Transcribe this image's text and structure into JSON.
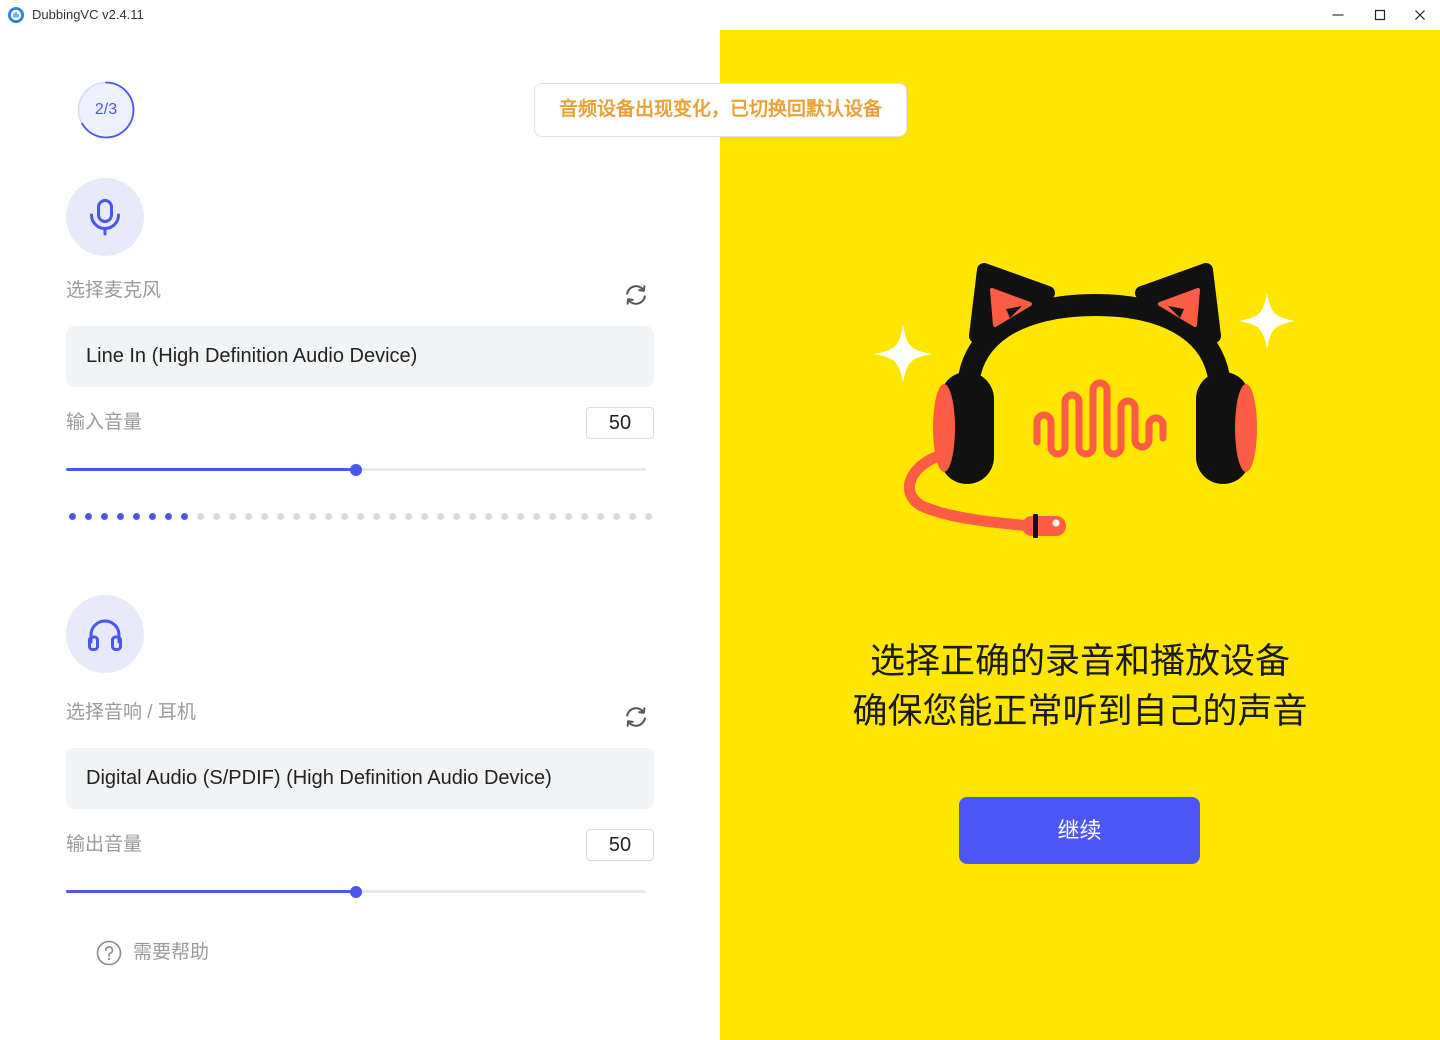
{
  "window": {
    "title": "DubbingVC v2.4.11",
    "logo_icon": "app-logo-icon",
    "controls": {
      "minimize_icon": "minimize-icon",
      "maximize_icon": "maximize-icon",
      "close_icon": "close-icon"
    }
  },
  "step": {
    "label": "2/3",
    "current": 2,
    "total": 3
  },
  "toast": {
    "message": "音频设备出现变化，已切换回默认设备"
  },
  "microphone": {
    "icon": "mic-icon",
    "label": "选择麦克风",
    "refresh_icon": "refresh-icon",
    "selected_device": "Line In (High Definition Audio Device)",
    "volume_label": "输入音量",
    "volume_value": "50",
    "volume_level": 0.5,
    "level_meter": {
      "active_dots": 8,
      "total_dots": 37
    }
  },
  "speaker": {
    "icon": "headphones-icon",
    "label": "选择音响 / 耳机",
    "refresh_icon": "refresh-icon",
    "selected_device": "Digital Audio (S/PDIF) (High Definition Audio Device)",
    "volume_label": "输出音量",
    "volume_value": "50",
    "volume_level": 0.5
  },
  "help": {
    "icon": "help-icon",
    "label": "需要帮助"
  },
  "hero": {
    "headline_line1": "选择正确的录音和播放设备",
    "headline_line2": "确保您能正常听到自己的声音",
    "continue_button": "继续"
  },
  "colors": {
    "accent": "#4B55F0",
    "button": "#4D56F8",
    "panel_yellow": "#FFE600",
    "toast_text": "#E9A23B",
    "illustration_red": "#FF5C45",
    "field_background": "#F2F3F5",
    "icon_circle_background": "#E9EAF9",
    "label_gray": "#9A9A9A"
  }
}
